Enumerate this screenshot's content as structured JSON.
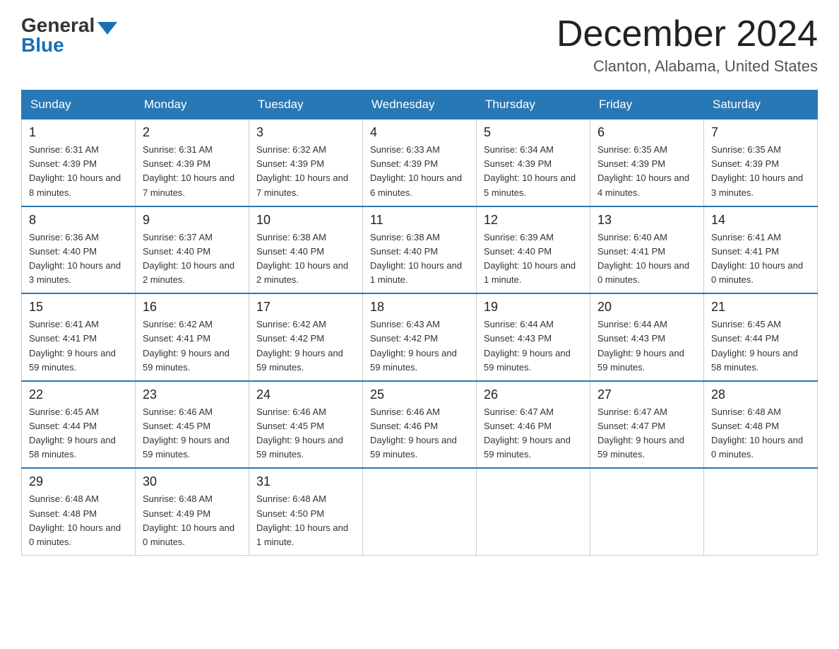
{
  "header": {
    "logo_general": "General",
    "logo_blue": "Blue",
    "month_title": "December 2024",
    "location": "Clanton, Alabama, United States"
  },
  "days_of_week": [
    "Sunday",
    "Monday",
    "Tuesday",
    "Wednesday",
    "Thursday",
    "Friday",
    "Saturday"
  ],
  "weeks": [
    [
      {
        "day": "1",
        "sunrise": "6:31 AM",
        "sunset": "4:39 PM",
        "daylight": "10 hours and 8 minutes."
      },
      {
        "day": "2",
        "sunrise": "6:31 AM",
        "sunset": "4:39 PM",
        "daylight": "10 hours and 7 minutes."
      },
      {
        "day": "3",
        "sunrise": "6:32 AM",
        "sunset": "4:39 PM",
        "daylight": "10 hours and 7 minutes."
      },
      {
        "day": "4",
        "sunrise": "6:33 AM",
        "sunset": "4:39 PM",
        "daylight": "10 hours and 6 minutes."
      },
      {
        "day": "5",
        "sunrise": "6:34 AM",
        "sunset": "4:39 PM",
        "daylight": "10 hours and 5 minutes."
      },
      {
        "day": "6",
        "sunrise": "6:35 AM",
        "sunset": "4:39 PM",
        "daylight": "10 hours and 4 minutes."
      },
      {
        "day": "7",
        "sunrise": "6:35 AM",
        "sunset": "4:39 PM",
        "daylight": "10 hours and 3 minutes."
      }
    ],
    [
      {
        "day": "8",
        "sunrise": "6:36 AM",
        "sunset": "4:40 PM",
        "daylight": "10 hours and 3 minutes."
      },
      {
        "day": "9",
        "sunrise": "6:37 AM",
        "sunset": "4:40 PM",
        "daylight": "10 hours and 2 minutes."
      },
      {
        "day": "10",
        "sunrise": "6:38 AM",
        "sunset": "4:40 PM",
        "daylight": "10 hours and 2 minutes."
      },
      {
        "day": "11",
        "sunrise": "6:38 AM",
        "sunset": "4:40 PM",
        "daylight": "10 hours and 1 minute."
      },
      {
        "day": "12",
        "sunrise": "6:39 AM",
        "sunset": "4:40 PM",
        "daylight": "10 hours and 1 minute."
      },
      {
        "day": "13",
        "sunrise": "6:40 AM",
        "sunset": "4:41 PM",
        "daylight": "10 hours and 0 minutes."
      },
      {
        "day": "14",
        "sunrise": "6:41 AM",
        "sunset": "4:41 PM",
        "daylight": "10 hours and 0 minutes."
      }
    ],
    [
      {
        "day": "15",
        "sunrise": "6:41 AM",
        "sunset": "4:41 PM",
        "daylight": "9 hours and 59 minutes."
      },
      {
        "day": "16",
        "sunrise": "6:42 AM",
        "sunset": "4:41 PM",
        "daylight": "9 hours and 59 minutes."
      },
      {
        "day": "17",
        "sunrise": "6:42 AM",
        "sunset": "4:42 PM",
        "daylight": "9 hours and 59 minutes."
      },
      {
        "day": "18",
        "sunrise": "6:43 AM",
        "sunset": "4:42 PM",
        "daylight": "9 hours and 59 minutes."
      },
      {
        "day": "19",
        "sunrise": "6:44 AM",
        "sunset": "4:43 PM",
        "daylight": "9 hours and 59 minutes."
      },
      {
        "day": "20",
        "sunrise": "6:44 AM",
        "sunset": "4:43 PM",
        "daylight": "9 hours and 59 minutes."
      },
      {
        "day": "21",
        "sunrise": "6:45 AM",
        "sunset": "4:44 PM",
        "daylight": "9 hours and 58 minutes."
      }
    ],
    [
      {
        "day": "22",
        "sunrise": "6:45 AM",
        "sunset": "4:44 PM",
        "daylight": "9 hours and 58 minutes."
      },
      {
        "day": "23",
        "sunrise": "6:46 AM",
        "sunset": "4:45 PM",
        "daylight": "9 hours and 59 minutes."
      },
      {
        "day": "24",
        "sunrise": "6:46 AM",
        "sunset": "4:45 PM",
        "daylight": "9 hours and 59 minutes."
      },
      {
        "day": "25",
        "sunrise": "6:46 AM",
        "sunset": "4:46 PM",
        "daylight": "9 hours and 59 minutes."
      },
      {
        "day": "26",
        "sunrise": "6:47 AM",
        "sunset": "4:46 PM",
        "daylight": "9 hours and 59 minutes."
      },
      {
        "day": "27",
        "sunrise": "6:47 AM",
        "sunset": "4:47 PM",
        "daylight": "9 hours and 59 minutes."
      },
      {
        "day": "28",
        "sunrise": "6:48 AM",
        "sunset": "4:48 PM",
        "daylight": "10 hours and 0 minutes."
      }
    ],
    [
      {
        "day": "29",
        "sunrise": "6:48 AM",
        "sunset": "4:48 PM",
        "daylight": "10 hours and 0 minutes."
      },
      {
        "day": "30",
        "sunrise": "6:48 AM",
        "sunset": "4:49 PM",
        "daylight": "10 hours and 0 minutes."
      },
      {
        "day": "31",
        "sunrise": "6:48 AM",
        "sunset": "4:50 PM",
        "daylight": "10 hours and 1 minute."
      },
      null,
      null,
      null,
      null
    ]
  ],
  "labels": {
    "sunrise": "Sunrise:",
    "sunset": "Sunset:",
    "daylight": "Daylight:"
  }
}
